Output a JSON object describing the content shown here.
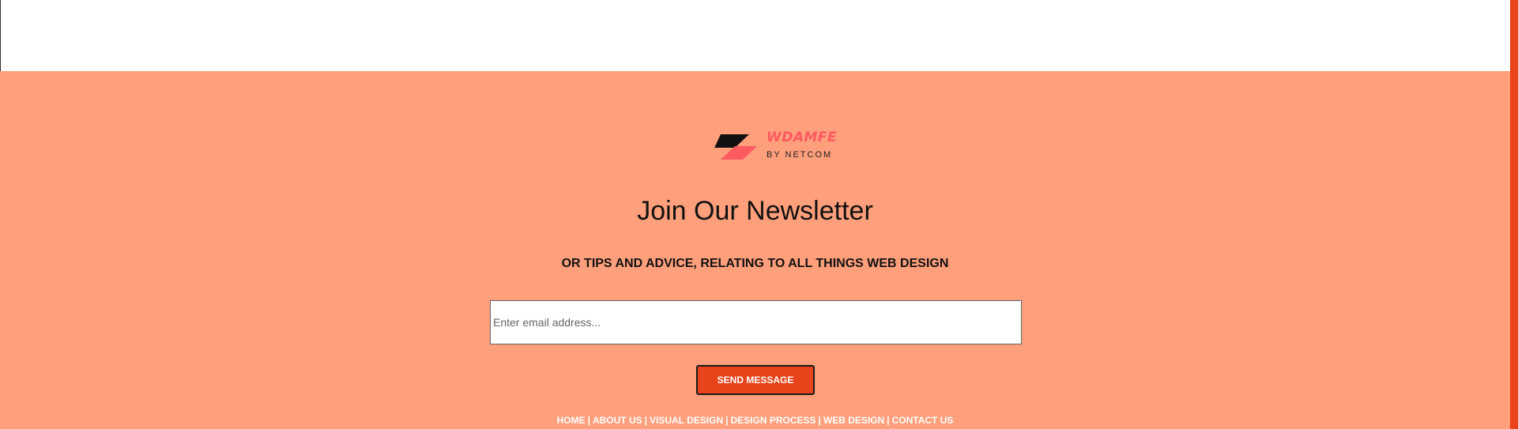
{
  "brand": {
    "name": "WDAMFE",
    "tagline": "BY NETCOM",
    "accent_color": "#ff5a60"
  },
  "newsletter": {
    "title": "Join Our Newsletter",
    "subtitle": "OR TIPS AND ADVICE, RELATING TO ALL THINGS WEB DESIGN",
    "email_placeholder": "Enter email address...",
    "email_value": "",
    "submit_label": "SEND MESSAGE"
  },
  "footer_nav": {
    "separator": "|",
    "items": [
      {
        "label": "HOME"
      },
      {
        "label": "ABOUT US"
      },
      {
        "label": "VISUAL DESIGN"
      },
      {
        "label": "DESIGN PROCESS"
      },
      {
        "label": "WEB DESIGN"
      },
      {
        "label": "CONTACT US"
      }
    ]
  },
  "colors": {
    "footer_background": "#ff9f7b",
    "button_background": "#e8431a",
    "side_bar": "#e8431a"
  }
}
